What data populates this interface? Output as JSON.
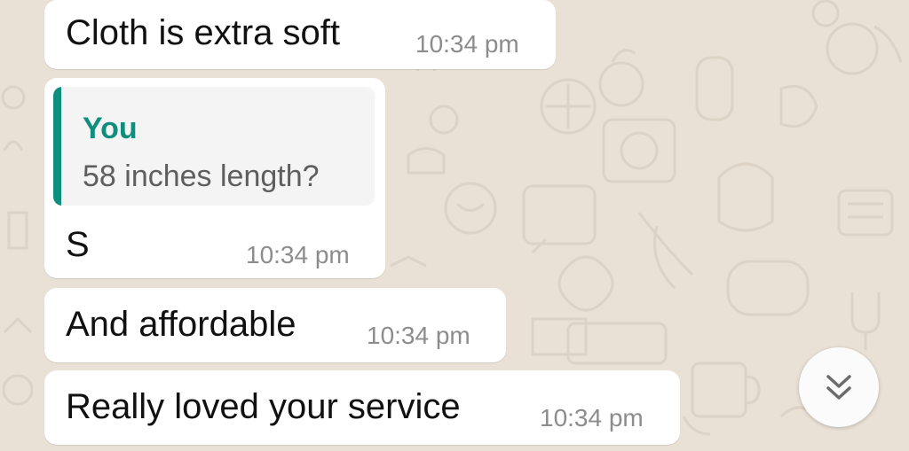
{
  "messages": [
    {
      "text": "Cloth is extra soft",
      "time": "10:34 pm"
    },
    {
      "quote": {
        "author": "You",
        "text": "58 inches length?"
      },
      "text": "S",
      "time": "10:34 pm"
    },
    {
      "text": "And affordable",
      "time": "10:34 pm"
    },
    {
      "text": "Really loved your service",
      "time": "10:34 pm"
    }
  ],
  "scroll_button": {
    "icon": "double-chevron-down-icon"
  },
  "colors": {
    "chat_background": "#e9e1d6",
    "bubble": "#ffffff",
    "quote_accent": "#0e8f7e",
    "timestamp": "#8c8c8c"
  }
}
